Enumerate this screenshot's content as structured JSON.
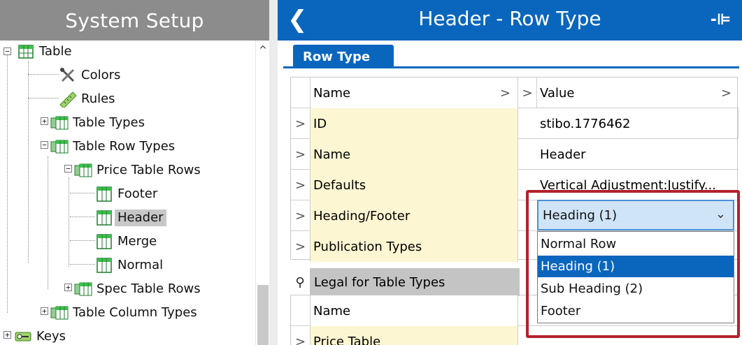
{
  "left_panel": {
    "title": "System Setup",
    "tree": [
      {
        "label": "Table",
        "icon": "table-icon"
      },
      {
        "label": "Colors",
        "icon": "tools-icon"
      },
      {
        "label": "Rules",
        "icon": "ruler-icon"
      },
      {
        "label": "Table Types",
        "icon": "table-folder-icon"
      },
      {
        "label": "Table Row Types",
        "icon": "table-folder-icon"
      },
      {
        "label": "Price Table Rows",
        "icon": "table-folder-icon"
      },
      {
        "label": "Footer",
        "icon": "row-type-icon"
      },
      {
        "label": "Header",
        "icon": "row-type-icon",
        "selected": true
      },
      {
        "label": "Merge",
        "icon": "row-type-icon"
      },
      {
        "label": "Normal",
        "icon": "row-type-icon"
      },
      {
        "label": "Spec Table Rows",
        "icon": "table-folder-icon"
      },
      {
        "label": "Table Column Types",
        "icon": "table-folder-icon"
      },
      {
        "label": "Keys",
        "icon": "keys-icon"
      }
    ]
  },
  "right_panel": {
    "title": "Header - Row Type",
    "tab": "Row Type",
    "columns": {
      "name": "Name",
      "value": "Value"
    },
    "rows": [
      {
        "name": "ID",
        "value": "stibo.1776462"
      },
      {
        "name": "Name",
        "value": "Header"
      },
      {
        "name": "Defaults",
        "value": "Vertical Adjustment:Justify..."
      },
      {
        "name": "Heading/Footer",
        "value": ""
      },
      {
        "name": "Publication Types",
        "value": ""
      }
    ],
    "group": {
      "label": "Legal for Table Types"
    },
    "group_columns": {
      "name": "Name"
    },
    "group_rows": [
      {
        "name": "Price Table"
      }
    ]
  },
  "dropdown": {
    "selected": "Heading (1)",
    "options": [
      "Normal Row",
      "Heading (1)",
      "Sub Heading (2)",
      "Footer"
    ],
    "highlighted_index": 1
  },
  "colors": {
    "accent": "#0a66bd",
    "highlight_box": "#b3222e",
    "name_cell_bg": "#fdf6d2",
    "left_header_bg": "#8c8c8c"
  }
}
